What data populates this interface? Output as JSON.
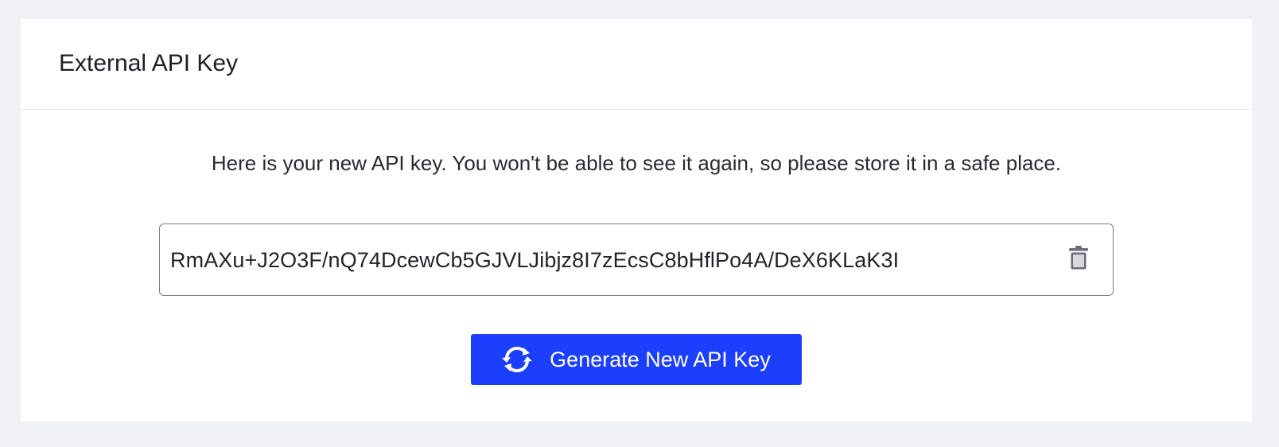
{
  "card": {
    "title": "External API Key"
  },
  "notice": {
    "text": "Here is your new API key. You won't be able to see it again, so please store it in a safe place."
  },
  "api_key": {
    "value": "RmAXu+J2O3F/nQ74DcewCb5GJVLJibjz8I7zEcsC8bHflPo4A/DeX6KLaK3I",
    "delete_icon": "trash-icon",
    "delete_icon_color": "#6b6d7a"
  },
  "generate_button": {
    "label": "Generate New API Key",
    "icon": "refresh-icon",
    "background": "#1c3ffd",
    "text_color": "#ffffff"
  }
}
